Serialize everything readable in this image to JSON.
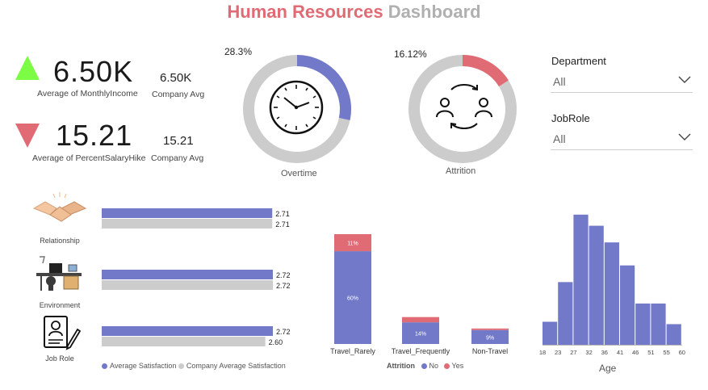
{
  "title": {
    "part1": "Human Resources",
    "part2": "Dashboard"
  },
  "kpis": [
    {
      "value": "6.50K",
      "label": "Average of MonthlyIncome",
      "company_value": "6.50K",
      "company_label": "Company Avg",
      "trend": "up",
      "trend_color": "#7cfc45"
    },
    {
      "value": "15.21",
      "label": "Average of PercentSalaryHike",
      "company_value": "15.21",
      "company_label": "Company Avg",
      "trend": "down",
      "trend_color": "#e06b75"
    }
  ],
  "donuts": {
    "overtime": {
      "percent_label": "28.3%",
      "percent": 28.3,
      "label": "Overtime",
      "color": "#7279c9",
      "icon": "clock-icon"
    },
    "attrition": {
      "percent_label": "16.12%",
      "percent": 16.12,
      "label": "Attrition",
      "color": "#e06b75",
      "icon": "people-cycle-icon"
    }
  },
  "slicers": [
    {
      "title": "Department",
      "value": "All"
    },
    {
      "title": "JobRole",
      "value": "All"
    }
  ],
  "satisfaction": {
    "rows": [
      {
        "label": "Relationship",
        "icon": "handshake-icon",
        "average": 2.71,
        "company": 2.71,
        "average_label": "2.71",
        "company_label": "2.71"
      },
      {
        "label": "Environment",
        "icon": "office-desk-icon",
        "average": 2.72,
        "company": 2.72,
        "average_label": "2.72",
        "company_label": "2.72"
      },
      {
        "label": "Job Role",
        "icon": "resume-icon",
        "average": 2.72,
        "company": 2.6,
        "average_label": "2.72",
        "company_label": "2.60"
      }
    ],
    "legend": [
      {
        "name": "Average Satisfaction",
        "color": "#7279c9"
      },
      {
        "name": "Company Average Satisfaction",
        "color": "#cccccc"
      }
    ]
  },
  "chart_data": [
    {
      "type": "bar",
      "stacked": true,
      "categories": [
        "Travel_Rarely",
        "Travel_Frequently",
        "Non-Travel"
      ],
      "series": [
        {
          "name": "No",
          "values": [
            60,
            14,
            9
          ],
          "labels": [
            "60%",
            "14%",
            "9%"
          ],
          "color": "#7279c9"
        },
        {
          "name": "Yes",
          "values": [
            11,
            3.4,
            1
          ],
          "labels": [
            "11%",
            "",
            ""
          ],
          "color": "#e06b75"
        }
      ],
      "legend_title": "Attrition",
      "legend": "bottom",
      "ylim": [
        0,
        80
      ]
    },
    {
      "type": "bar",
      "categories": [
        "18",
        "23",
        "27",
        "32",
        "36",
        "41",
        "46",
        "51",
        "55",
        "60"
      ],
      "values": [
        29,
        79,
        164,
        150,
        129,
        100,
        52,
        52,
        26
      ],
      "color": "#7279c9",
      "xlabel": "Age",
      "ylim": [
        0,
        175
      ]
    }
  ]
}
